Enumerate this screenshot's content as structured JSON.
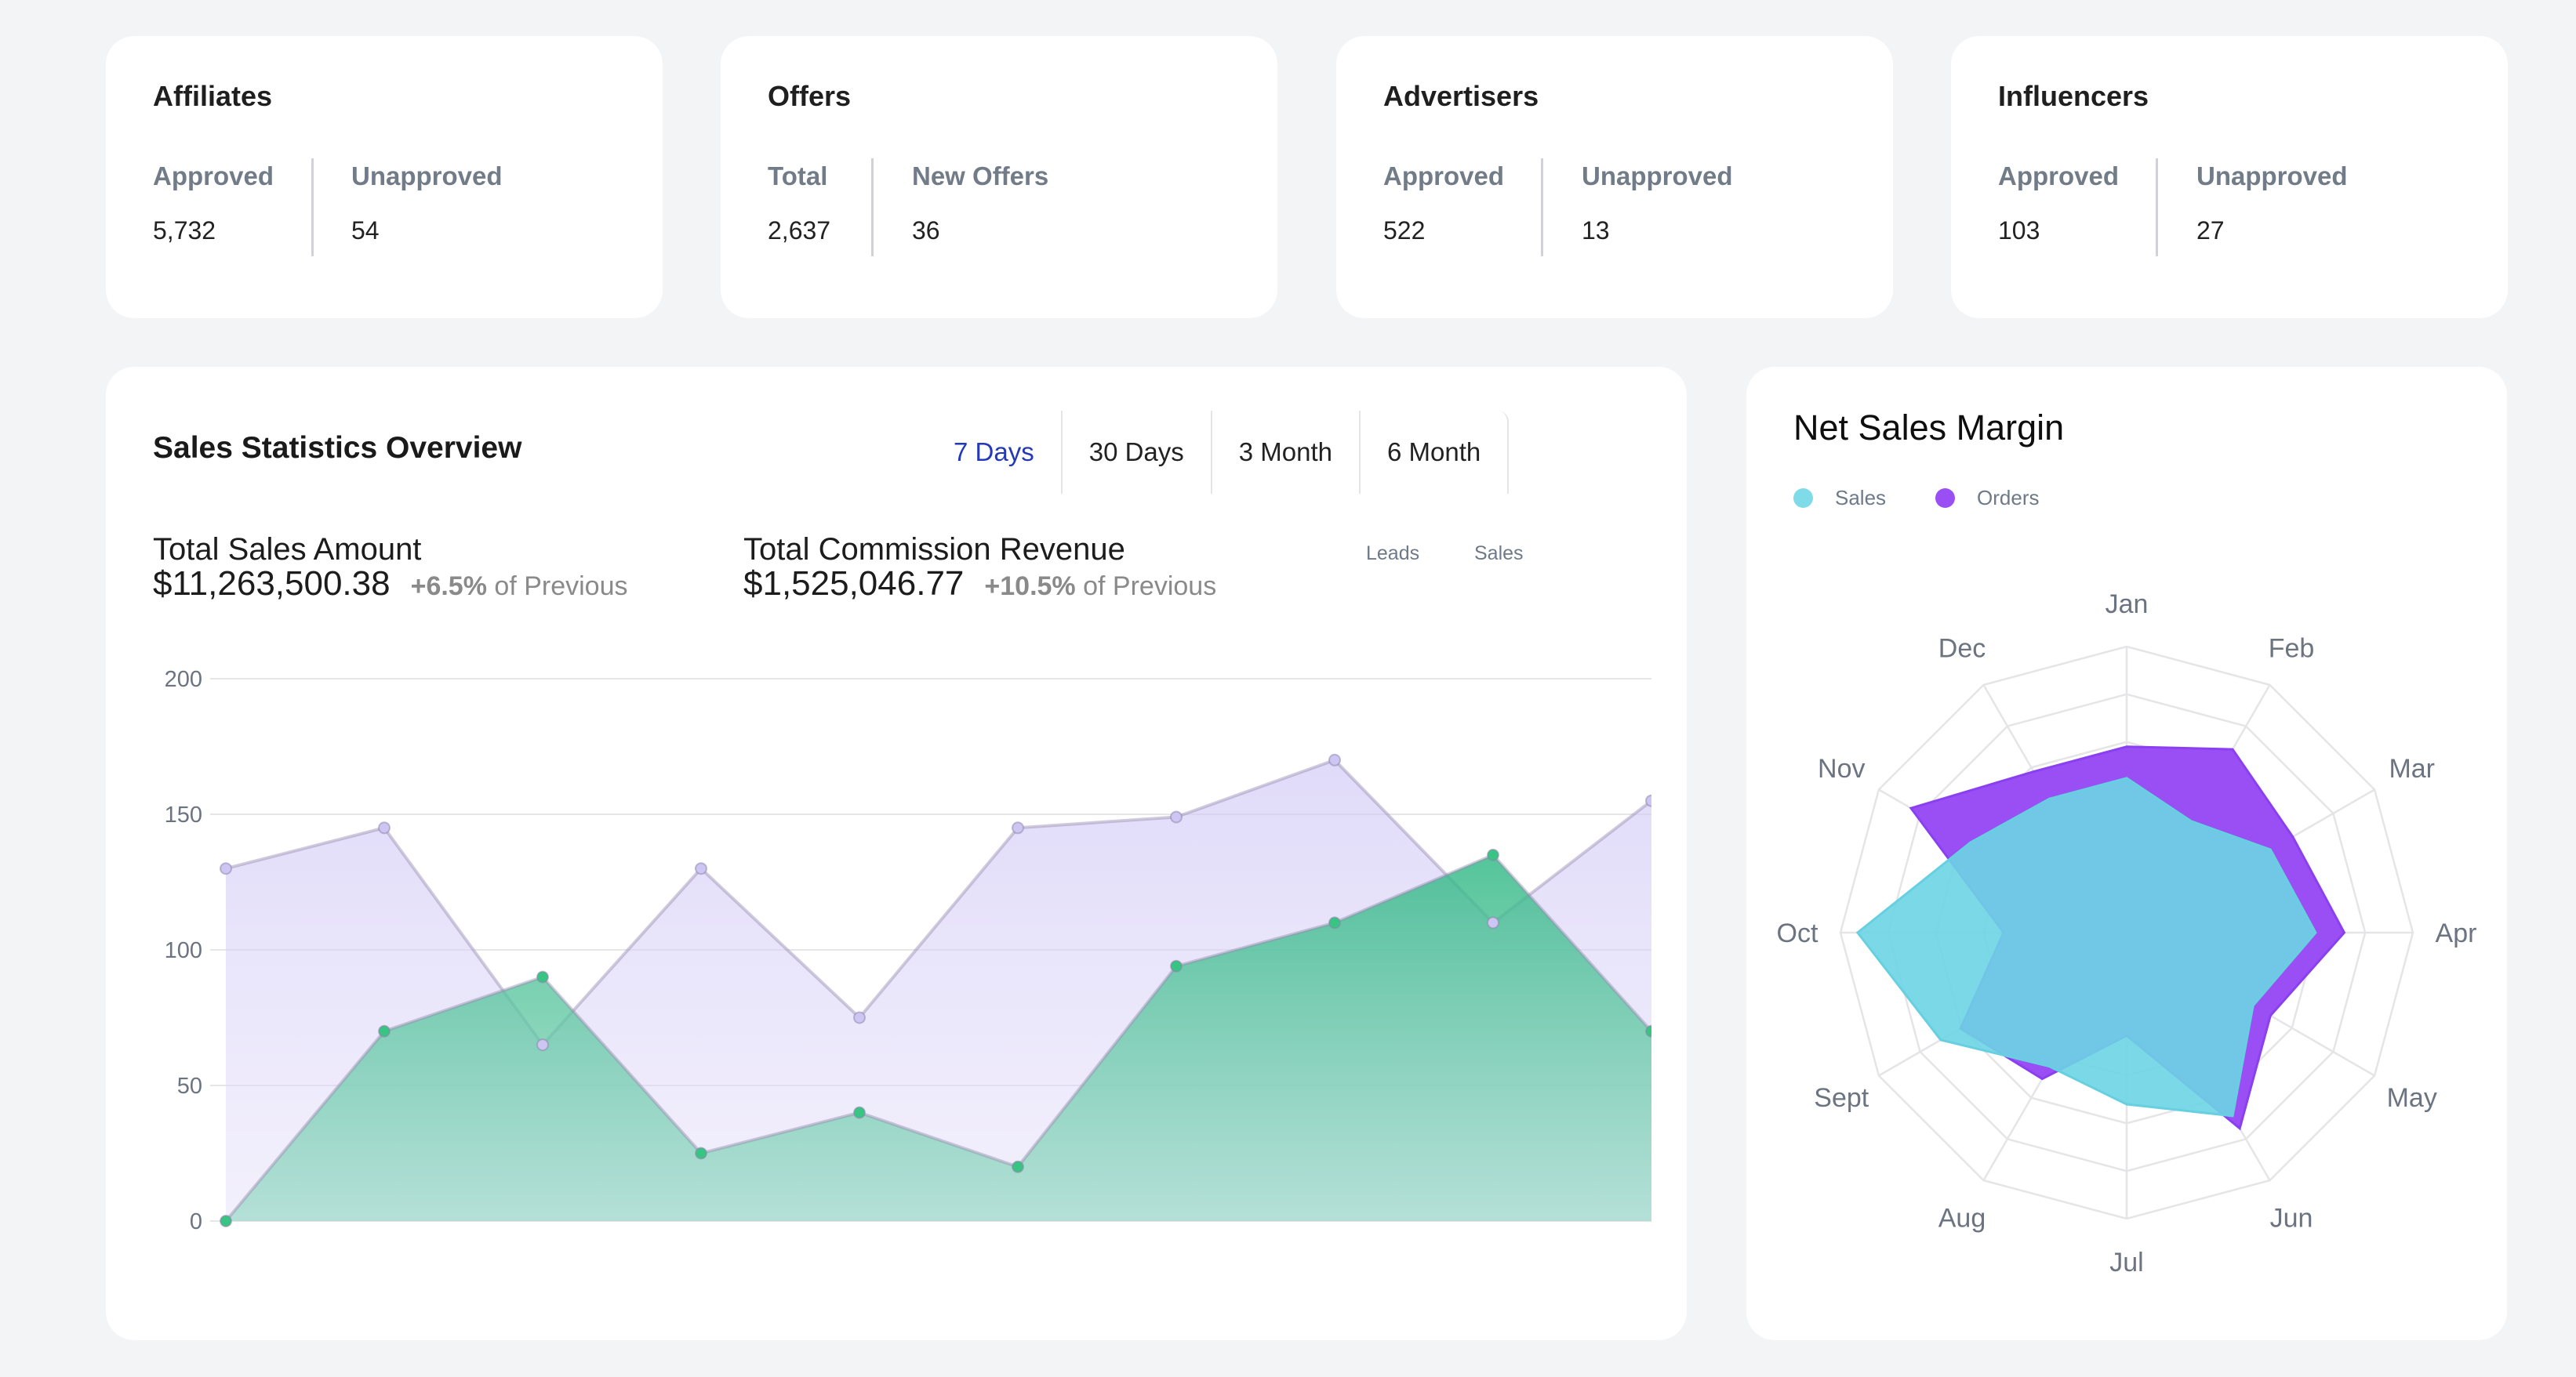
{
  "stat_cards": [
    {
      "title": "Affiliates",
      "cols": [
        {
          "label": "Approved",
          "value": "5,732"
        },
        {
          "label": "Unapproved",
          "value": "54"
        }
      ]
    },
    {
      "title": "Offers",
      "cols": [
        {
          "label": "Total",
          "value": "2,637"
        },
        {
          "label": "New Offers",
          "value": "36"
        }
      ]
    },
    {
      "title": "Advertisers",
      "cols": [
        {
          "label": "Approved",
          "value": "522"
        },
        {
          "label": "Unapproved",
          "value": "13"
        }
      ]
    },
    {
      "title": "Influencers",
      "cols": [
        {
          "label": "Approved",
          "value": "103"
        },
        {
          "label": "Unapproved",
          "value": "27"
        }
      ]
    }
  ],
  "sales_overview": {
    "title": "Sales Statistics Overview",
    "tabs": [
      {
        "label": "7 Days",
        "active": true
      },
      {
        "label": "30 Days",
        "active": false
      },
      {
        "label": "3 Month",
        "active": false
      },
      {
        "label": "6 Month",
        "active": false
      }
    ],
    "metrics": [
      {
        "label": "Total Sales Amount",
        "value": "$11,263,500.38",
        "delta": "+6.5%",
        "delta_suffix": "of Previous"
      },
      {
        "label": "Total Commission Revenue",
        "value": "$1,525,046.77",
        "delta": "+10.5%",
        "delta_suffix": "of Previous"
      }
    ],
    "series_toggles": [
      "Leads",
      "Sales"
    ]
  },
  "net_sales_margin": {
    "title": "Net Sales Margin",
    "legend": [
      {
        "label": "Sales",
        "color": "#7fdbe8"
      },
      {
        "label": "Orders",
        "color": "#9a4ff5"
      }
    ]
  },
  "chart_data": [
    {
      "type": "area",
      "title": "Sales Statistics Overview",
      "xlabel": "",
      "ylabel": "",
      "ylim": [
        0,
        200
      ],
      "yticks": [
        0,
        50,
        100,
        150,
        200
      ],
      "grid": true,
      "x": [
        1,
        2,
        3,
        4,
        5,
        6,
        7,
        8,
        9,
        10
      ],
      "series": [
        {
          "name": "Leads",
          "color": "#b9b0f0",
          "values": [
            130,
            145,
            65,
            130,
            75,
            145,
            149,
            170,
            110,
            155
          ]
        },
        {
          "name": "Sales",
          "color": "#3cc58a",
          "values": [
            0,
            70,
            90,
            25,
            40,
            20,
            94,
            110,
            135,
            70
          ]
        }
      ]
    },
    {
      "type": "radar",
      "title": "Net Sales Margin",
      "categories": [
        "Jan",
        "Feb",
        "Mar",
        "Apr",
        "May",
        "Jun",
        "Jul",
        "Aug",
        "Sept",
        "Oct",
        "Nov",
        "Dec"
      ],
      "rmax": 1,
      "rings": 6,
      "legend_position": "top-left",
      "series": [
        {
          "name": "Orders",
          "color": "#9a4ff5",
          "values": [
            0.65,
            0.74,
            0.67,
            0.76,
            0.58,
            0.79,
            0.36,
            0.59,
            0.67,
            0.43,
            0.87,
            0.65
          ]
        },
        {
          "name": "Sales",
          "color": "#6dd4e4",
          "values": [
            0.54,
            0.45,
            0.58,
            0.66,
            0.51,
            0.74,
            0.6,
            0.54,
            0.75,
            0.94,
            0.63,
            0.54
          ]
        }
      ]
    }
  ]
}
